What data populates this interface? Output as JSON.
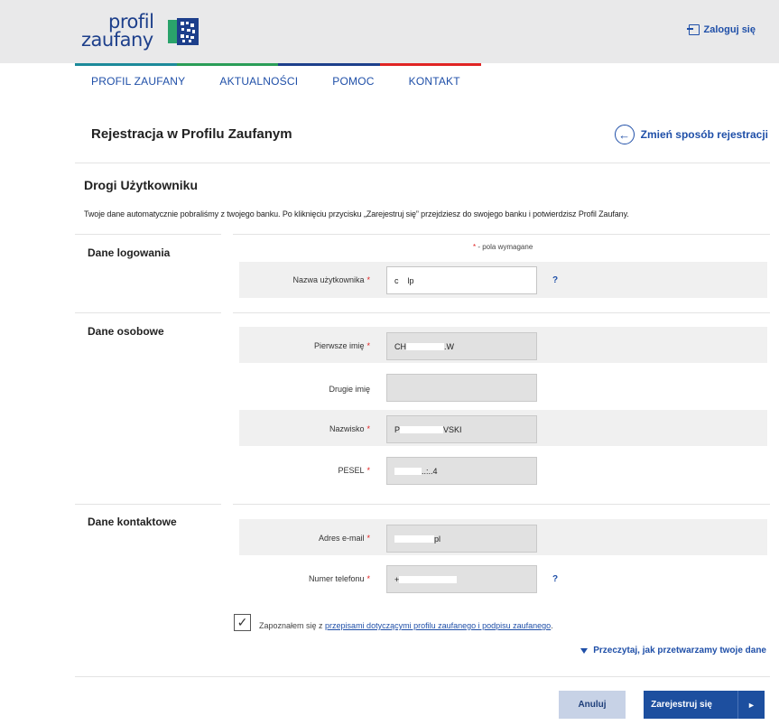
{
  "header": {
    "logo_line1": "profil",
    "logo_line2": "zaufany",
    "login_label": "Zaloguj się",
    "colorbar_colors": [
      "#1c8a9a",
      "#2a9d57",
      "#1d3f8b",
      "#e02424"
    ]
  },
  "nav": {
    "items": [
      "PROFIL ZAUFANY",
      "AKTUALNOŚCI",
      "POMOC",
      "KONTAKT"
    ]
  },
  "page": {
    "title": "Rejestracja w Profilu Zaufanym",
    "change_method": "Zmień sposób rejestracji",
    "greeting": "Drogi Użytkowniku",
    "intro": "Twoje dane automatycznie pobraliśmy z twojego banku. Po kliknięciu przycisku „Zarejestruj się” przejdziesz do swojego banku i potwierdzisz Profil Zaufany.",
    "required_note": " - pola wymagane",
    "required_star": "*"
  },
  "sections": {
    "login": "Dane logowania",
    "personal": "Dane osobowe",
    "contact": "Dane kontaktowe"
  },
  "fields": {
    "username": {
      "label": "Nazwa użytkownika",
      "value_start": "c",
      "value_end": "lp",
      "required": "*"
    },
    "first_name": {
      "label": "Pierwsze imię",
      "value_start": "CH",
      "value_end": ".W",
      "required": "*"
    },
    "second_name": {
      "label": "Drugie imię",
      "value": ""
    },
    "surname": {
      "label": "Nazwisko",
      "value_start": "P",
      "value_end": "VSKI",
      "required": "*"
    },
    "pesel": {
      "label": "PESEL",
      "value_end": "..:..4",
      "required": "*"
    },
    "email": {
      "label": "Adres e-mail",
      "value_end": "pl",
      "required": "*"
    },
    "phone": {
      "label": "Numer telefonu",
      "value_start": "+",
      "required": "*"
    }
  },
  "help_symbol": "?",
  "consent": {
    "checked_symbol": "✓",
    "text": "Zapoznałem się z ",
    "link": "przepisami dotyczącymi profilu zaufanego i podpisu zaufanego",
    "period": "."
  },
  "read_more": "Przeczytaj, jak przetwarzamy twoje dane",
  "buttons": {
    "cancel": "Anuluj",
    "register": "Zarejestruj się",
    "register_arrow": "►"
  }
}
